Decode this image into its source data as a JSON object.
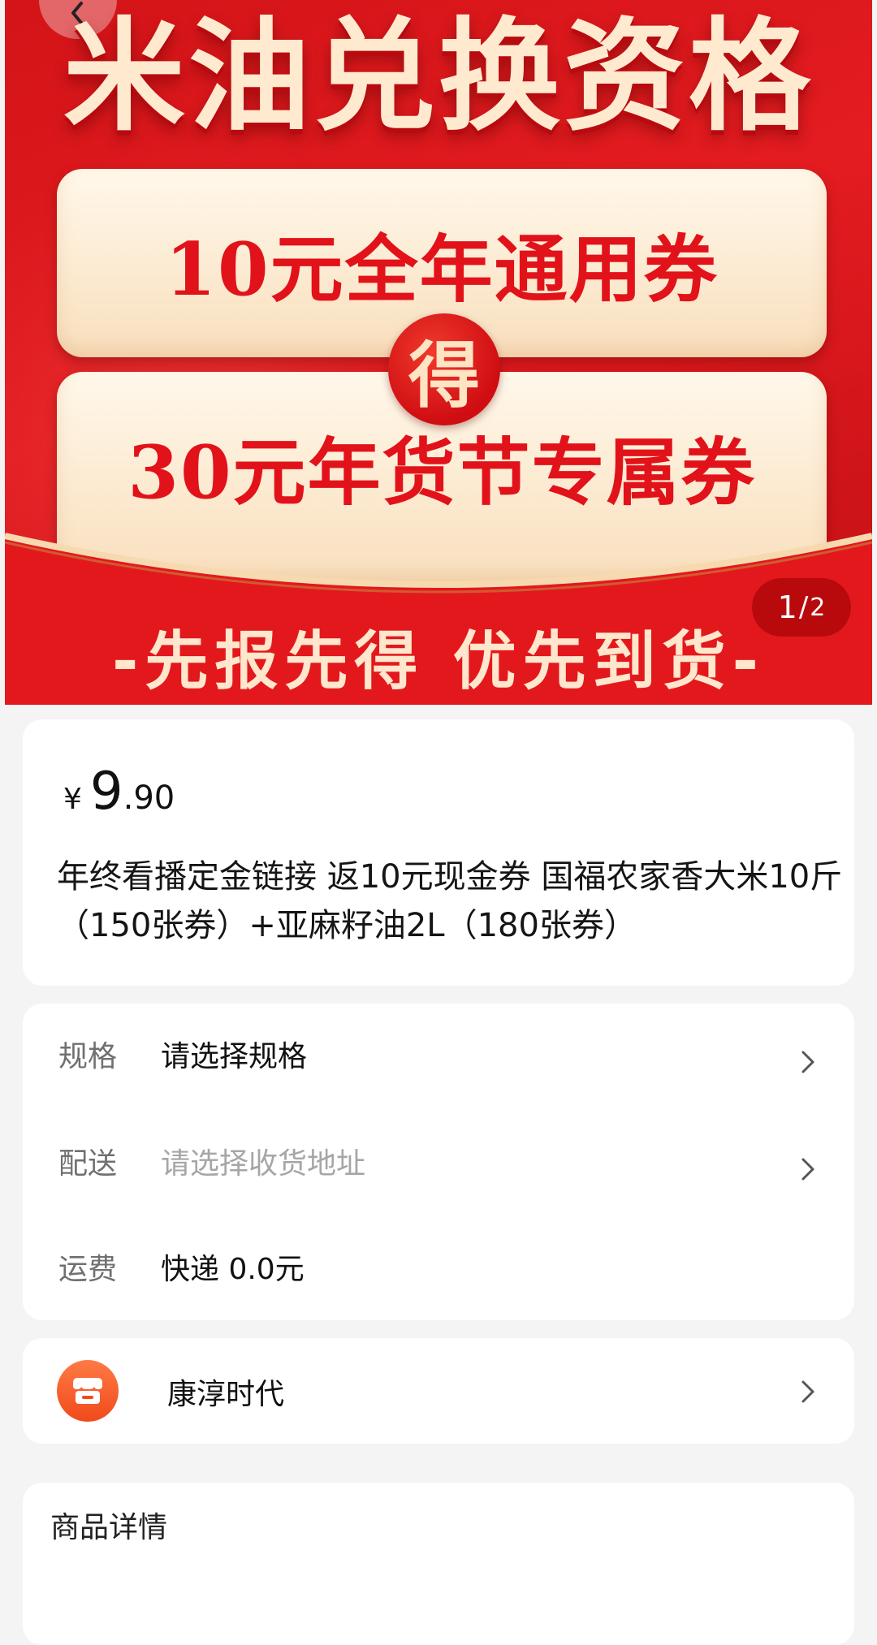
{
  "banner": {
    "title": "米油兑换资格",
    "coupon_1": "10元全年通用券",
    "connector": "得",
    "coupon_2": "30元年货节专属券",
    "slogan": "-先报先得 优先到货-",
    "page_indicator": {
      "current": "1",
      "separator": "/",
      "total": "2"
    }
  },
  "product": {
    "currency_symbol": "¥",
    "price_integer": "9",
    "price_decimal": ".90",
    "title": "年终看播定金链接 返10元现金券 国福农家香大米10斤（150张券）+亚麻籽油2L（180张券）"
  },
  "specs": {
    "spec_label": "规格",
    "spec_value": "请选择规格",
    "delivery_label": "配送",
    "delivery_placeholder": "请选择收货地址",
    "fee_label": "运费",
    "fee_value": "快递 0.0元"
  },
  "shop": {
    "name": "康淳时代"
  },
  "details": {
    "title": "商品详情"
  },
  "colors": {
    "banner_red": "#e31c20",
    "coupon_text": "#e2121a",
    "banner_title": "#ffe9cf",
    "shop_logo": "#f04a1c"
  },
  "icons": [
    "back-icon",
    "chevron-right-icon",
    "shop-icon"
  ]
}
